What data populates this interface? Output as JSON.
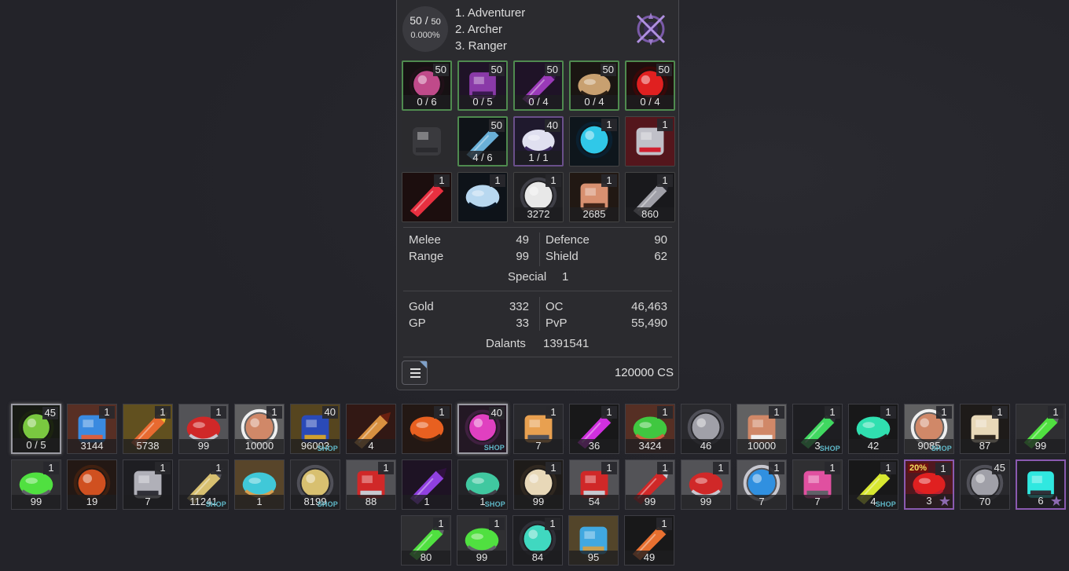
{
  "character": {
    "level": "50",
    "level_max": "50",
    "exp_percent": "0.000%",
    "classes": [
      "1. Adventurer",
      "2. Archer",
      "3. Ranger"
    ],
    "class_emblem_icon": "crossed-blades-emblem-icon"
  },
  "equipment": [
    {
      "id": "helmet",
      "icon": "helmet-icon",
      "level": "50",
      "durability": "0 / 6",
      "border": "green",
      "colors": [
        "#c04a8a",
        "#201018"
      ]
    },
    {
      "id": "upper",
      "icon": "upper-armor-icon",
      "level": "50",
      "durability": "0 / 5",
      "border": "green",
      "colors": [
        "#8a3aa8",
        "#3a1850"
      ]
    },
    {
      "id": "gloves",
      "icon": "gloves-icon",
      "level": "50",
      "durability": "0 / 4",
      "border": "green",
      "colors": [
        "#9a3ab8",
        "#3a1850"
      ]
    },
    {
      "id": "shoes",
      "icon": "shoes-icon",
      "level": "50",
      "durability": "0 / 4",
      "border": "green",
      "colors": [
        "#c8a070",
        "#2a1e14"
      ]
    },
    {
      "id": "cape",
      "icon": "cape-icon",
      "level": "50",
      "durability": "0 / 4",
      "border": "green",
      "colors": [
        "#e02020",
        "#3a0808"
      ]
    },
    {
      "id": "shield",
      "icon": "shield-silhouette-icon",
      "level": "",
      "durability": "",
      "border": "empty",
      "colors": [
        "#3a3a3e",
        "#2b2b2f"
      ]
    },
    {
      "id": "weapon",
      "icon": "bow-icon",
      "level": "50",
      "durability": "4 / 6",
      "border": "green",
      "colors": [
        "#6ab0d8",
        "#0c1824"
      ]
    },
    {
      "id": "pet",
      "icon": "unicorn-icon",
      "level": "40",
      "durability": "1 / 1",
      "border": "purple",
      "colors": [
        "#e0e0f0",
        "#3a2860"
      ]
    },
    {
      "id": "ring1",
      "icon": "cyan-ring-icon",
      "level": "1",
      "durability": "",
      "border": "none",
      "colors": [
        "#30c8e8",
        "#0a2030"
      ]
    },
    {
      "id": "ring2",
      "icon": "red-gem-ring-icon",
      "level": "1",
      "durability": "",
      "border": "none",
      "colors": [
        "#c0c0c8",
        "#d02030"
      ]
    },
    {
      "id": "amulet1",
      "icon": "red-tribal-amulet-icon",
      "level": "1",
      "durability": "",
      "border": "none",
      "colors": [
        "#e83040",
        "#300808"
      ]
    },
    {
      "id": "amulet2",
      "icon": "blue-tribal-amulet-icon",
      "level": "1",
      "durability": "",
      "border": "none",
      "colors": [
        "#b8d8f0",
        "#0a1828"
      ]
    },
    {
      "id": "ammo1",
      "icon": "white-ammo-icon",
      "level": "1",
      "durability": "3272",
      "border": "none",
      "colors": [
        "#e8e8e8",
        "#404048"
      ]
    },
    {
      "id": "ammo2",
      "icon": "copper-ammo-icon",
      "level": "1",
      "durability": "2685",
      "border": "none",
      "colors": [
        "#d89070",
        "#402418"
      ]
    },
    {
      "id": "ammo3",
      "icon": "grey-ammo-icon",
      "level": "1",
      "durability": "860",
      "border": "none",
      "colors": [
        "#a0a0a8",
        "#282830"
      ]
    }
  ],
  "stats": {
    "melee_label": "Melee",
    "melee": "49",
    "range_label": "Range",
    "range": "99",
    "defence_label": "Defence",
    "defence": "90",
    "shield_label": "Shield",
    "shield": "62",
    "special_label": "Special",
    "special": "1"
  },
  "currency": {
    "gold_label": "Gold",
    "gold": "332",
    "gp_label": "GP",
    "gp": "33",
    "oc_label": "OC",
    "oc": "46,463",
    "pvp_label": "PvP",
    "pvp": "55,490",
    "dalants_label": "Dalants",
    "dalants": "1391541"
  },
  "footer": {
    "cs_total": "120000 CS",
    "menu_icon": "hamburger-menu-icon"
  },
  "inventory": [
    [
      {
        "icon": "green-arrow-bundle-icon",
        "level": "45",
        "count": "0 / 5",
        "badge": "",
        "frame": "sel",
        "colors": [
          "#7ac840",
          "#1c2410"
        ]
      },
      {
        "icon": "blue-ammo-icon",
        "level": "1",
        "count": "3144",
        "badge": "",
        "frame": "",
        "colors": [
          "#3a8ae0",
          "#d86040"
        ]
      },
      {
        "icon": "orange-ammo-icon",
        "level": "1",
        "count": "5738",
        "badge": "",
        "frame": "",
        "colors": [
          "#e86a30",
          "#f0c030"
        ]
      },
      {
        "icon": "red-potion-flask-icon",
        "level": "1",
        "count": "99",
        "badge": "",
        "frame": "",
        "colors": [
          "#d02828",
          "#c8c8d0"
        ]
      },
      {
        "icon": "copper-ammo-icon",
        "level": "1",
        "count": "10000",
        "badge": "",
        "frame": "",
        "colors": [
          "#d08868",
          "#f0f0f0"
        ]
      },
      {
        "icon": "blue-armor-set-icon",
        "level": "40",
        "count": "96003",
        "badge": "shop",
        "frame": "",
        "colors": [
          "#2a4ab8",
          "#d0a030"
        ]
      },
      {
        "icon": "winged-emblem-icon",
        "level": "",
        "count": "4",
        "badge": "",
        "frame": "",
        "colors": [
          "#d89040",
          "#6a2010"
        ]
      },
      {
        "icon": "fire-crystal-box-icon",
        "level": "1",
        "count": "",
        "badge": "",
        "frame": "",
        "colors": [
          "#e86020",
          "#402010"
        ]
      },
      {
        "icon": "pink-orb-icon",
        "level": "40",
        "count": "",
        "badge": "shop",
        "frame": "sel",
        "colors": [
          "#e040c0",
          "#402040"
        ]
      },
      {
        "icon": "ornate-medallion-icon",
        "level": "1",
        "count": "7",
        "badge": "",
        "frame": "",
        "colors": [
          "#e8a050",
          "#505058"
        ]
      },
      {
        "icon": "magenta-vial-icon",
        "level": "1",
        "count": "36",
        "badge": "",
        "frame": "",
        "colors": [
          "#d030e0",
          "#202020"
        ]
      },
      {
        "icon": "green-ammo-icon",
        "level": "1",
        "count": "3424",
        "badge": "",
        "frame": "",
        "colors": [
          "#40c840",
          "#d06040"
        ]
      },
      {
        "icon": "silver-crate-icon",
        "level": "",
        "count": "46",
        "badge": "",
        "frame": "",
        "colors": [
          "#a0a0a8",
          "#505058"
        ]
      },
      {
        "icon": "copper-ammo-icon",
        "level": "1",
        "count": "10000",
        "badge": "",
        "frame": "",
        "colors": [
          "#d08868",
          "#f0f0f0"
        ]
      },
      {
        "icon": "green-orb-lantern-icon",
        "level": "1",
        "count": "3",
        "badge": "shop",
        "frame": "",
        "colors": [
          "#40d860",
          "#303038"
        ]
      },
      {
        "icon": "teal-vial-icon",
        "level": "1",
        "count": "42",
        "badge": "",
        "frame": "",
        "colors": [
          "#30e0b0",
          "#202020"
        ]
      },
      {
        "icon": "copper-ammo-icon",
        "level": "1",
        "count": "9085",
        "badge": "shop",
        "frame": "",
        "colors": [
          "#d08868",
          "#f0f0f0"
        ]
      },
      {
        "icon": "beige-vial-icon",
        "level": "1",
        "count": "87",
        "badge": "",
        "frame": "",
        "colors": [
          "#e8d8b8",
          "#302820"
        ]
      },
      {
        "icon": "green-orb-icon",
        "level": "1",
        "count": "99",
        "badge": "",
        "frame": "",
        "colors": [
          "#50e040",
          "#606068"
        ]
      }
    ],
    [
      {
        "icon": "green-orb-icon",
        "level": "1",
        "count": "99",
        "badge": "",
        "frame": "",
        "colors": [
          "#50e040",
          "#606068"
        ]
      },
      {
        "icon": "molten-ore-icon",
        "level": "",
        "count": "19",
        "badge": "",
        "frame": "",
        "colors": [
          "#d05020",
          "#402010"
        ]
      },
      {
        "icon": "turret-chest-icon",
        "level": "1",
        "count": "7",
        "badge": "",
        "frame": "",
        "colors": [
          "#b0b0b8",
          "#303038"
        ]
      },
      {
        "icon": "gold-cannon-icon",
        "level": "1",
        "count": "11241",
        "badge": "shop",
        "frame": "",
        "colors": [
          "#d8c070",
          "#505058"
        ]
      },
      {
        "icon": "cyan-pocket-watch-icon",
        "level": "",
        "count": "1",
        "badge": "",
        "frame": "",
        "colors": [
          "#40c8d8",
          "#d8a050"
        ]
      },
      {
        "icon": "gold-cannon-icon",
        "level": "",
        "count": "8199",
        "badge": "shop",
        "frame": "",
        "colors": [
          "#d8c070",
          "#505058"
        ]
      },
      {
        "icon": "red-potion-flask-icon",
        "level": "1",
        "count": "88",
        "badge": "",
        "frame": "",
        "colors": [
          "#d02828",
          "#c8c8d0"
        ]
      },
      {
        "icon": "purple-aura-icon",
        "level": "",
        "count": "1",
        "badge": "",
        "frame": "",
        "colors": [
          "#9040e0",
          "#301040"
        ]
      },
      {
        "icon": "robot-head-icon",
        "level": "",
        "count": "1",
        "badge": "shop",
        "frame": "",
        "colors": [
          "#40c8a0",
          "#404048"
        ]
      },
      {
        "icon": "beige-vial-icon",
        "level": "1",
        "count": "99",
        "badge": "",
        "frame": "",
        "colors": [
          "#e8d8b8",
          "#302820"
        ]
      },
      {
        "icon": "red-potion-flask-icon",
        "level": "1",
        "count": "54",
        "badge": "",
        "frame": "",
        "colors": [
          "#d02828",
          "#c8c8d0"
        ]
      },
      {
        "icon": "red-potion-flask-icon",
        "level": "1",
        "count": "99",
        "badge": "",
        "frame": "",
        "colors": [
          "#d02828",
          "#c8c8d0"
        ]
      },
      {
        "icon": "red-potion-flask-icon",
        "level": "1",
        "count": "99",
        "badge": "",
        "frame": "",
        "colors": [
          "#d02828",
          "#c8c8d0"
        ]
      },
      {
        "icon": "blue-potion-flask-icon",
        "level": "1",
        "count": "7",
        "badge": "",
        "frame": "",
        "colors": [
          "#3090e0",
          "#c8c8d0"
        ]
      },
      {
        "icon": "pink-orb-ring-icon",
        "level": "1",
        "count": "7",
        "badge": "",
        "frame": "",
        "colors": [
          "#e050a0",
          "#606068"
        ]
      },
      {
        "icon": "yellow-vial-icon",
        "level": "1",
        "count": "4",
        "badge": "shop",
        "frame": "",
        "colors": [
          "#d8e830",
          "#202020"
        ]
      },
      {
        "icon": "red-potion-bottle-icon",
        "level": "1",
        "count": "3",
        "badge": "star",
        "frame": "purp",
        "colors": [
          "#e02020",
          "#c02030"
        ],
        "tag": "20%"
      },
      {
        "icon": "silver-crate-icon",
        "level": "45",
        "count": "70",
        "badge": "",
        "frame": "",
        "colors": [
          "#a0a0a8",
          "#505058"
        ]
      },
      {
        "icon": "cyan-tube-vial-icon",
        "level": "",
        "count": "6",
        "badge": "star",
        "frame": "purp",
        "colors": [
          "#30e8e0",
          "#303038"
        ]
      }
    ],
    [
      {
        "icon": "green-orb-icon",
        "level": "1",
        "count": "80",
        "badge": "",
        "frame": "",
        "colors": [
          "#50e040",
          "#606068"
        ]
      },
      {
        "icon": "green-orb-icon",
        "level": "1",
        "count": "99",
        "badge": "",
        "frame": "",
        "colors": [
          "#50e040",
          "#606068"
        ]
      },
      {
        "icon": "radio-terminal-icon",
        "level": "1",
        "count": "84",
        "badge": "",
        "frame": "",
        "colors": [
          "#40d8c0",
          "#303038"
        ]
      },
      {
        "icon": "blue-ore-icon",
        "level": "",
        "count": "95",
        "badge": "",
        "frame": "",
        "colors": [
          "#40a8e0",
          "#c8a050"
        ]
      },
      {
        "icon": "orange-vial-icon",
        "level": "1",
        "count": "49",
        "badge": "",
        "frame": "",
        "colors": [
          "#e87030",
          "#202020"
        ]
      }
    ]
  ]
}
